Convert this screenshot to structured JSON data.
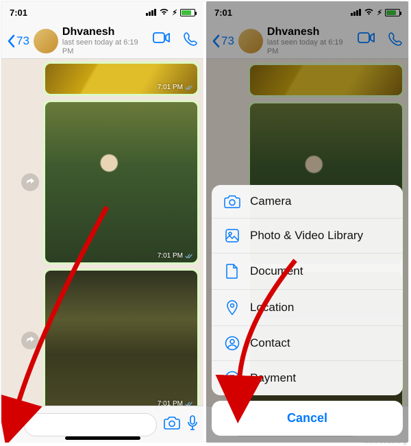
{
  "status": {
    "time": "7:01",
    "charging_icon": "⚡︎"
  },
  "nav": {
    "back_count": "73",
    "name": "Dhvanesh",
    "subtitle": "last seen today at 6:19 PM"
  },
  "messages": {
    "ts1": "7:01 PM",
    "ts2": "7:01 PM",
    "ts3": "7:01 PM"
  },
  "sheet": {
    "items": [
      {
        "icon": "camera",
        "label": "Camera"
      },
      {
        "icon": "photo",
        "label": "Photo & Video Library"
      },
      {
        "icon": "doc",
        "label": "Document"
      },
      {
        "icon": "pin",
        "label": "Location"
      },
      {
        "icon": "contact",
        "label": "Contact"
      },
      {
        "icon": "rupee",
        "label": "Payment"
      }
    ],
    "cancel": "Cancel"
  },
  "watermark": "www.deua.org"
}
